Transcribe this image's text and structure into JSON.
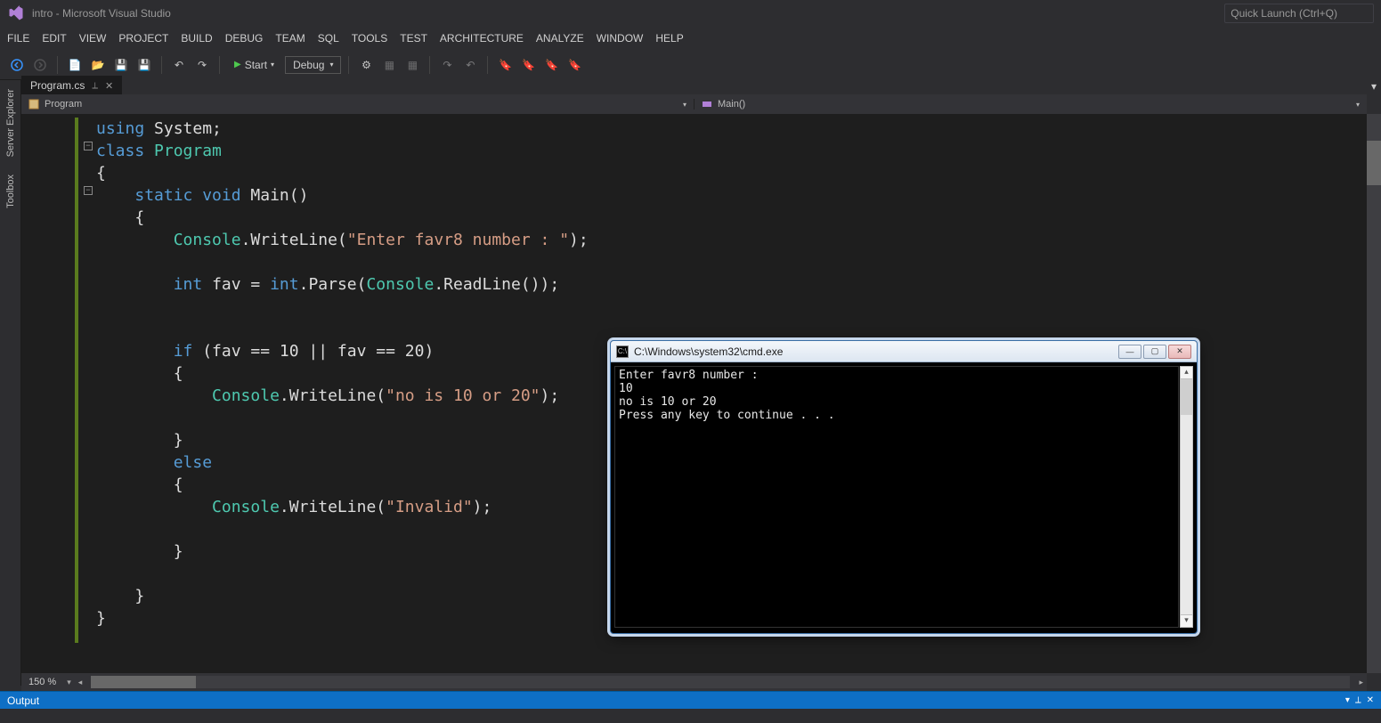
{
  "title": "intro - Microsoft Visual Studio",
  "quicklaunch_placeholder": "Quick Launch (Ctrl+Q)",
  "menu": [
    "FILE",
    "EDIT",
    "VIEW",
    "PROJECT",
    "BUILD",
    "DEBUG",
    "TEAM",
    "SQL",
    "TOOLS",
    "TEST",
    "ARCHITECTURE",
    "ANALYZE",
    "WINDOW",
    "HELP"
  ],
  "toolbar": {
    "start_label": "Start",
    "config": "Debug"
  },
  "side_tabs": [
    "Server Explorer",
    "Toolbox"
  ],
  "file_tab": "Program.cs",
  "nav": {
    "class": "Program",
    "member": "Main()"
  },
  "code_tokens": [
    [
      {
        "t": "using ",
        "c": "kw"
      },
      {
        "t": "System;",
        "c": "plain"
      }
    ],
    [
      {
        "t": "class ",
        "c": "kw"
      },
      {
        "t": "Program",
        "c": "type"
      }
    ],
    [
      {
        "t": "{",
        "c": "plain"
      }
    ],
    [
      {
        "t": "    ",
        "c": "plain"
      },
      {
        "t": "static void ",
        "c": "kw"
      },
      {
        "t": "Main()",
        "c": "plain"
      }
    ],
    [
      {
        "t": "    {",
        "c": "plain"
      }
    ],
    [
      {
        "t": "        ",
        "c": "plain"
      },
      {
        "t": "Console",
        "c": "type"
      },
      {
        "t": ".WriteLine(",
        "c": "plain"
      },
      {
        "t": "\"Enter favr8 number : \"",
        "c": "str"
      },
      {
        "t": ");",
        "c": "plain"
      }
    ],
    [
      {
        "t": " ",
        "c": "plain"
      }
    ],
    [
      {
        "t": "        ",
        "c": "plain"
      },
      {
        "t": "int ",
        "c": "kw"
      },
      {
        "t": "fav = ",
        "c": "plain"
      },
      {
        "t": "int",
        "c": "kw"
      },
      {
        "t": ".Parse(",
        "c": "plain"
      },
      {
        "t": "Console",
        "c": "type"
      },
      {
        "t": ".ReadLine());",
        "c": "plain"
      }
    ],
    [
      {
        "t": " ",
        "c": "plain"
      }
    ],
    [
      {
        "t": " ",
        "c": "plain"
      }
    ],
    [
      {
        "t": "        ",
        "c": "plain"
      },
      {
        "t": "if ",
        "c": "kw"
      },
      {
        "t": "(fav == 10 || fav == 20)",
        "c": "plain"
      }
    ],
    [
      {
        "t": "        {",
        "c": "plain"
      }
    ],
    [
      {
        "t": "            ",
        "c": "plain"
      },
      {
        "t": "Console",
        "c": "type"
      },
      {
        "t": ".WriteLine(",
        "c": "plain"
      },
      {
        "t": "\"no is 10 or 20\"",
        "c": "str"
      },
      {
        "t": ");",
        "c": "plain"
      }
    ],
    [
      {
        "t": " ",
        "c": "plain"
      }
    ],
    [
      {
        "t": "        }",
        "c": "plain"
      }
    ],
    [
      {
        "t": "        ",
        "c": "plain"
      },
      {
        "t": "else",
        "c": "kw"
      }
    ],
    [
      {
        "t": "        {",
        "c": "plain"
      }
    ],
    [
      {
        "t": "            ",
        "c": "plain"
      },
      {
        "t": "Console",
        "c": "type"
      },
      {
        "t": ".WriteLine(",
        "c": "plain"
      },
      {
        "t": "\"Invalid\"",
        "c": "str"
      },
      {
        "t": ");",
        "c": "plain"
      }
    ],
    [
      {
        "t": " ",
        "c": "plain"
      }
    ],
    [
      {
        "t": "        }",
        "c": "plain"
      }
    ],
    [
      {
        "t": " ",
        "c": "plain"
      }
    ],
    [
      {
        "t": "    }",
        "c": "plain"
      }
    ],
    [
      {
        "t": "}",
        "c": "plain"
      }
    ]
  ],
  "zoom": "150 %",
  "output_label": "Output",
  "console": {
    "title": "C:\\Windows\\system32\\cmd.exe",
    "lines": [
      "Enter favr8 number :",
      "10",
      "no is 10 or 20",
      "Press any key to continue . . ."
    ]
  }
}
